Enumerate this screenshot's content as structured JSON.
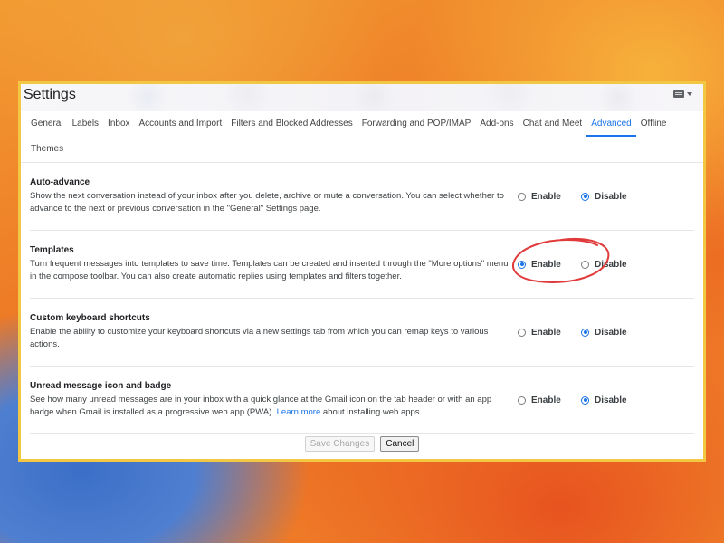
{
  "header": {
    "title": "Settings"
  },
  "tabs": [
    {
      "label": "General",
      "active": false
    },
    {
      "label": "Labels",
      "active": false
    },
    {
      "label": "Inbox",
      "active": false
    },
    {
      "label": "Accounts and Import",
      "active": false
    },
    {
      "label": "Filters and Blocked Addresses",
      "active": false
    },
    {
      "label": "Forwarding and POP/IMAP",
      "active": false
    },
    {
      "label": "Add-ons",
      "active": false
    },
    {
      "label": "Chat and Meet",
      "active": false
    },
    {
      "label": "Advanced",
      "active": true
    },
    {
      "label": "Offline",
      "active": false
    },
    {
      "label": "Themes",
      "active": false
    }
  ],
  "settings": [
    {
      "title": "Auto-advance",
      "desc": "Show the next conversation instead of your inbox after you delete, archive or mute a conversation. You can select whether to advance to the next or previous conversation in the \"General\" Settings page.",
      "enable_label": "Enable",
      "disable_label": "Disable",
      "selected": "Disable"
    },
    {
      "title": "Templates",
      "desc": "Turn frequent messages into templates to save time. Templates can be created and inserted through the \"More options\" menu in the compose toolbar. You can also create automatic replies using templates and filters together.",
      "enable_label": "Enable",
      "disable_label": "Disable",
      "selected": "Enable"
    },
    {
      "title": "Custom keyboard shortcuts",
      "desc": "Enable the ability to customize your keyboard shortcuts via a new settings tab from which you can remap keys to various actions.",
      "enable_label": "Enable",
      "disable_label": "Disable",
      "selected": "Disable"
    },
    {
      "title": "Unread message icon and badge",
      "desc": "See how many unread messages are in your inbox with a quick glance at the Gmail icon on the tab header or with an app badge when Gmail is installed as a progressive web app (PWA).",
      "link": "Learn more",
      "desc_after": "about installing web apps.",
      "enable_label": "Enable",
      "disable_label": "Disable",
      "selected": "Disable"
    }
  ],
  "actions": {
    "save_label": "Save Changes",
    "cancel_label": "Cancel"
  },
  "colors": {
    "accent": "#1a73e8",
    "annotation": "#e03a3a",
    "panel_border": "#f2c744"
  }
}
